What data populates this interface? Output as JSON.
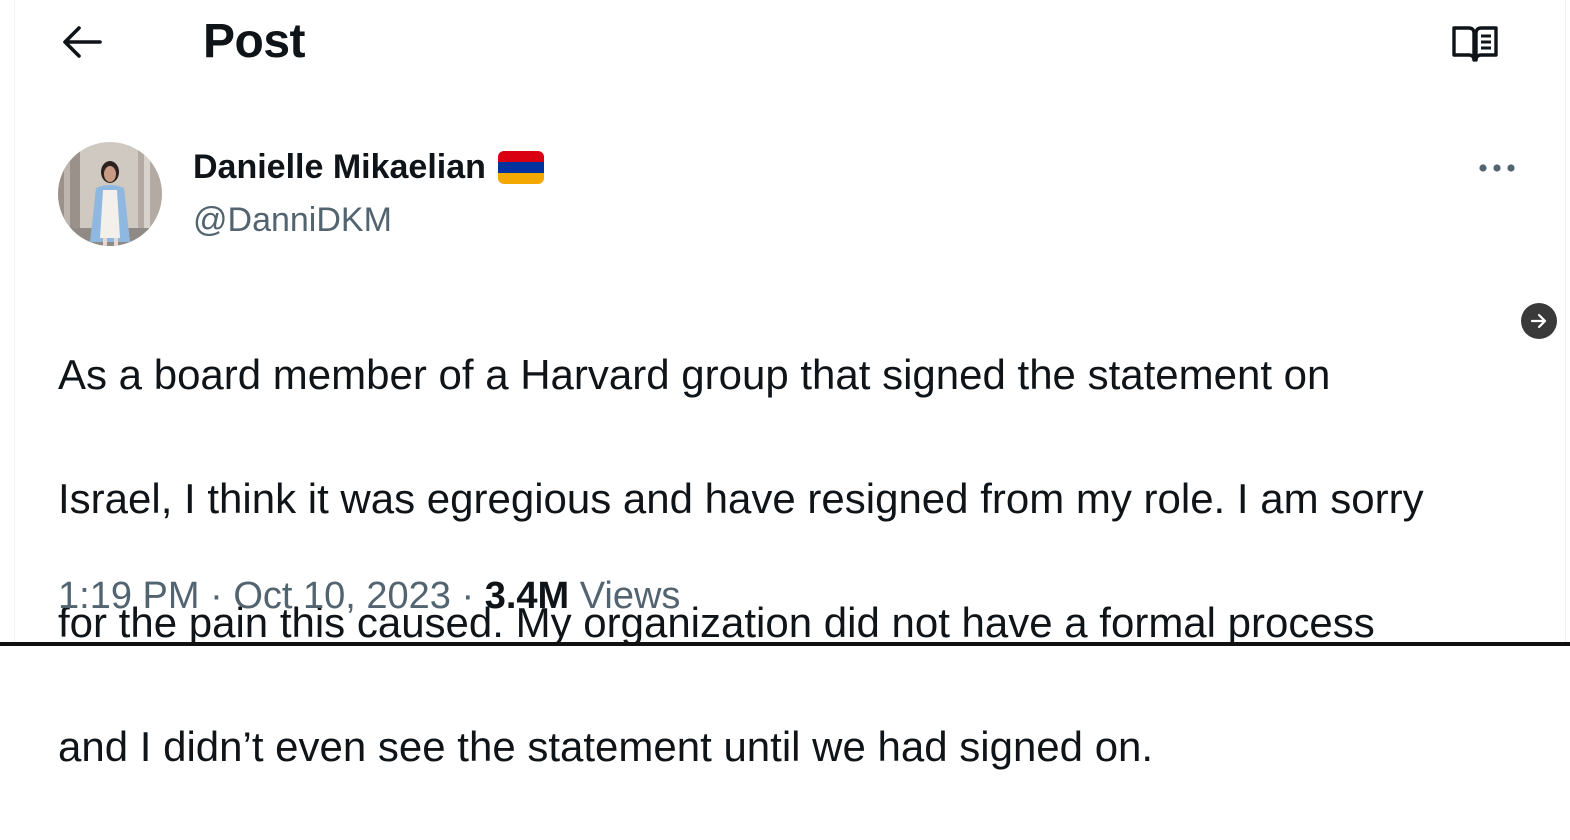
{
  "header": {
    "title": "Post",
    "back_icon": "arrow-left-icon",
    "reader_icon": "reader-mode-icon"
  },
  "tweet": {
    "author": {
      "display_name": "Danielle Mikaelian",
      "flag": "armenian-flag-icon",
      "handle": "@DanniDKM"
    },
    "more_icon": "more-options-icon",
    "text_lines": [
      "As a board member of a Harvard group that signed the statement on",
      "Israel, I think it was egregious and have resigned from my role. I am sorry",
      "for the pain this caused. My organization did not have a formal process",
      "and I didn’t even see the statement until we had signed on."
    ],
    "time": "1:19 PM",
    "separator": "·",
    "date": "Oct 10, 2023",
    "views_count": "3.4M",
    "views_label": "Views"
  },
  "colors": {
    "text_primary": "#0f1419",
    "text_secondary": "#536471",
    "flag_red": "#d90012",
    "flag_blue": "#0033a0",
    "flag_orange": "#f2a800"
  }
}
